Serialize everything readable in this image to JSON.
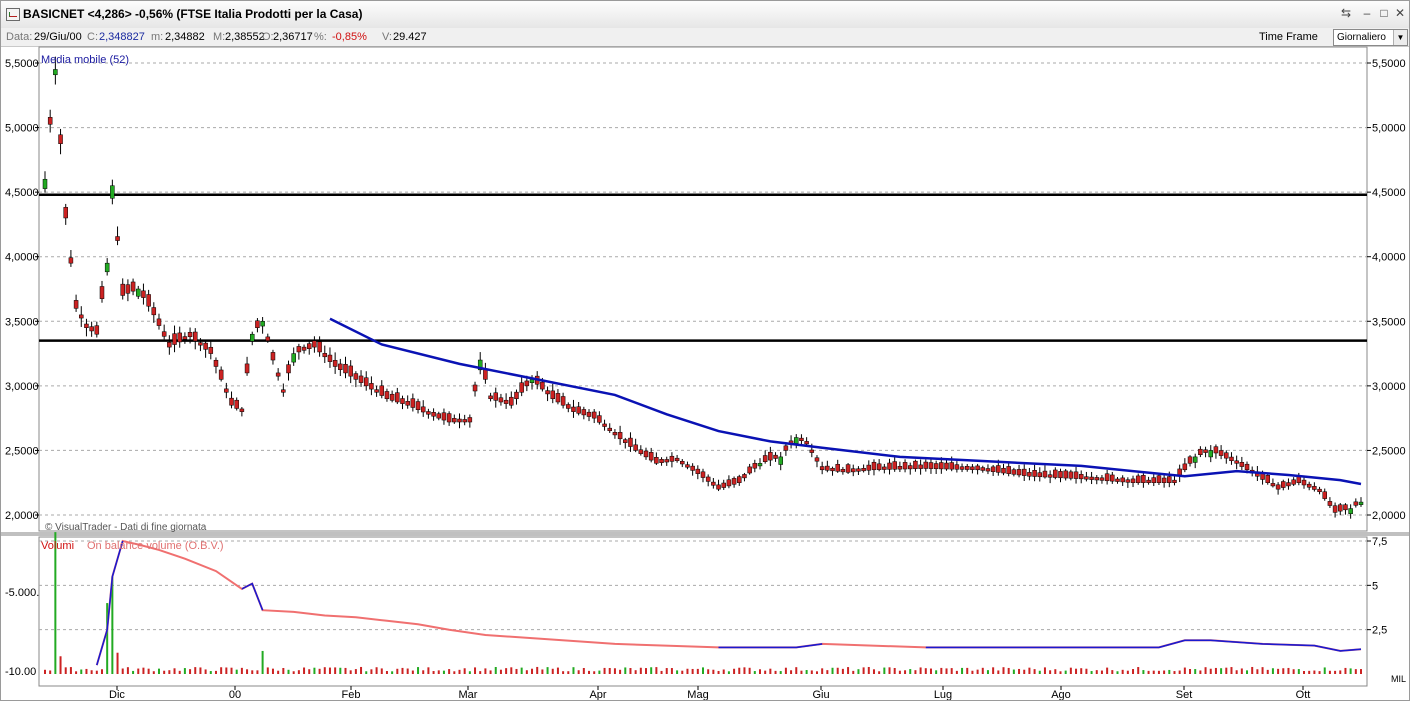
{
  "window": {
    "title": "BASICNET <4,286> -0,56%  (FTSE Italia Prodotti per la Casa)",
    "minimize": "–",
    "maximize": "□",
    "close": "✕",
    "restore": "⇆"
  },
  "infobar": {
    "date_label": "Data:",
    "date": "29/Giu/00",
    "close_label": "C:",
    "close": "2,348827",
    "min_label": "m:",
    "min": "2,34882",
    "max_label": "M:",
    "max": "2,38552",
    "open_label": "O:",
    "open": "2,36717",
    "pct_label": "%:",
    "pct": "-0,85%",
    "vol_label": "V:",
    "vol": "29.427",
    "timeframe_label": "Time Frame",
    "timeframe_value": "Giornaliero"
  },
  "colors": {
    "up": "#22aa22",
    "down": "#cc2222",
    "ma": "#0a12b4",
    "obv_red": "#f07070",
    "obv_blue": "#1a1ad0",
    "grid": "#aaaaaa"
  },
  "chart_data": [
    {
      "type": "candlestick",
      "indicator_label": "Media mobile (52)",
      "watermark": "© VisualTrader - Dati di fine giornata",
      "y_ticks": [
        "5,5000",
        "5,0000",
        "4,5000",
        "4,0000",
        "3,5000",
        "3,0000",
        "2,5000",
        "2,0000"
      ],
      "y_tick_values": [
        5.5,
        5.0,
        4.5,
        4.0,
        3.5,
        3.0,
        2.5,
        2.0
      ],
      "ylim": [
        1.93,
        5.55
      ],
      "horizontal_lines": [
        4.48,
        3.35
      ],
      "x_ticks": [
        "Dic",
        "00",
        "Feb",
        "Mar",
        "Apr",
        "Mag",
        "Giu",
        "Lug",
        "Ago",
        "Set",
        "Ott"
      ],
      "price_anchors": [
        [
          0,
          4.6,
          1
        ],
        [
          2,
          5.45,
          1
        ],
        [
          4,
          4.3,
          0
        ],
        [
          6,
          3.6,
          0
        ],
        [
          8,
          3.45,
          0
        ],
        [
          10,
          3.4,
          0
        ],
        [
          12,
          3.95,
          1
        ],
        [
          13,
          4.55,
          1
        ],
        [
          15,
          3.7,
          0
        ],
        [
          18,
          3.75,
          1
        ],
        [
          21,
          3.55,
          0
        ],
        [
          24,
          3.3,
          0
        ],
        [
          28,
          3.38,
          0
        ],
        [
          32,
          3.25,
          0
        ],
        [
          36,
          2.85,
          0
        ],
        [
          38,
          2.8,
          0
        ],
        [
          40,
          3.4,
          1
        ],
        [
          42,
          3.5,
          1
        ],
        [
          44,
          3.2,
          0
        ],
        [
          46,
          2.95,
          0
        ],
        [
          48,
          3.25,
          1
        ],
        [
          52,
          3.3,
          0
        ],
        [
          56,
          3.15,
          0
        ],
        [
          62,
          3.0,
          0
        ],
        [
          66,
          2.9,
          0
        ],
        [
          70,
          2.85,
          0
        ],
        [
          74,
          2.78,
          0
        ],
        [
          78,
          2.72,
          0
        ],
        [
          82,
          2.72,
          0
        ],
        [
          84,
          3.2,
          1
        ],
        [
          86,
          2.9,
          0
        ],
        [
          90,
          2.85,
          0
        ],
        [
          94,
          3.05,
          1
        ],
        [
          98,
          2.9,
          0
        ],
        [
          102,
          2.8,
          0
        ],
        [
          106,
          2.75,
          0
        ],
        [
          110,
          2.62,
          0
        ],
        [
          114,
          2.5,
          0
        ],
        [
          118,
          2.4,
          0
        ],
        [
          122,
          2.42,
          0
        ],
        [
          126,
          2.32,
          0
        ],
        [
          130,
          2.2,
          0
        ],
        [
          134,
          2.25,
          0
        ],
        [
          138,
          2.4,
          1
        ],
        [
          142,
          2.45,
          1
        ],
        [
          145,
          2.6,
          1
        ],
        [
          147,
          2.55,
          0
        ],
        [
          150,
          2.35,
          0
        ],
        [
          155,
          2.33,
          0
        ],
        [
          160,
          2.35,
          0
        ],
        [
          170,
          2.36,
          0
        ],
        [
          180,
          2.35,
          0
        ],
        [
          190,
          2.3,
          0
        ],
        [
          200,
          2.28,
          0
        ],
        [
          210,
          2.25,
          0
        ],
        [
          218,
          2.25,
          0
        ],
        [
          222,
          2.45,
          1
        ],
        [
          225,
          2.5,
          1
        ],
        [
          230,
          2.4,
          0
        ],
        [
          234,
          2.3,
          0
        ],
        [
          238,
          2.2,
          0
        ],
        [
          242,
          2.25,
          0
        ],
        [
          246,
          2.18,
          0
        ],
        [
          249,
          2.02,
          0
        ],
        [
          252,
          2.05,
          1
        ],
        [
          254,
          2.1,
          1
        ]
      ],
      "ma_points": [
        [
          55,
          3.52
        ],
        [
          65,
          3.32
        ],
        [
          80,
          3.17
        ],
        [
          95,
          3.05
        ],
        [
          110,
          2.93
        ],
        [
          120,
          2.78
        ],
        [
          130,
          2.65
        ],
        [
          140,
          2.57
        ],
        [
          150,
          2.52
        ],
        [
          165,
          2.45
        ],
        [
          180,
          2.42
        ],
        [
          200,
          2.38
        ],
        [
          220,
          2.3
        ],
        [
          230,
          2.34
        ],
        [
          240,
          2.31
        ],
        [
          250,
          2.27
        ],
        [
          254,
          2.24
        ]
      ]
    },
    {
      "type": "volume",
      "labels": [
        "Volumi",
        "On balance volume (O.B.V.)"
      ],
      "y_ticks_left": [
        "-5.000.",
        "-10.00"
      ],
      "y_ticks_right": [
        "7,5",
        "5",
        "2,5"
      ],
      "unit": "MIL",
      "obv_points": [
        [
          10,
          0.5
        ],
        [
          12,
          2.5
        ],
        [
          13,
          5.5
        ],
        [
          15,
          7.5
        ],
        [
          18,
          7.3
        ],
        [
          22,
          7.0
        ],
        [
          27,
          6.5
        ],
        [
          33,
          5.8
        ],
        [
          38,
          4.8
        ],
        [
          40,
          5.1
        ],
        [
          42,
          3.6
        ],
        [
          48,
          3.5
        ],
        [
          54,
          3.3
        ],
        [
          60,
          3.2
        ],
        [
          66,
          3.0
        ],
        [
          72,
          2.8
        ],
        [
          78,
          2.5
        ],
        [
          85,
          2.2
        ],
        [
          95,
          2.0
        ],
        [
          110,
          1.7
        ],
        [
          130,
          1.5
        ],
        [
          145,
          1.5
        ],
        [
          150,
          1.7
        ],
        [
          170,
          1.5
        ],
        [
          190,
          1.5
        ],
        [
          215,
          1.5
        ],
        [
          220,
          1.9
        ],
        [
          225,
          1.9
        ],
        [
          235,
          1.7
        ],
        [
          245,
          1.6
        ],
        [
          250,
          1.3
        ],
        [
          254,
          1.4
        ]
      ],
      "volume_spikes": [
        [
          2,
          8.0
        ],
        [
          12,
          4.0
        ],
        [
          13,
          5.5
        ],
        [
          14,
          1.2
        ],
        [
          42,
          1.3
        ],
        [
          3,
          1.0
        ]
      ]
    }
  ]
}
